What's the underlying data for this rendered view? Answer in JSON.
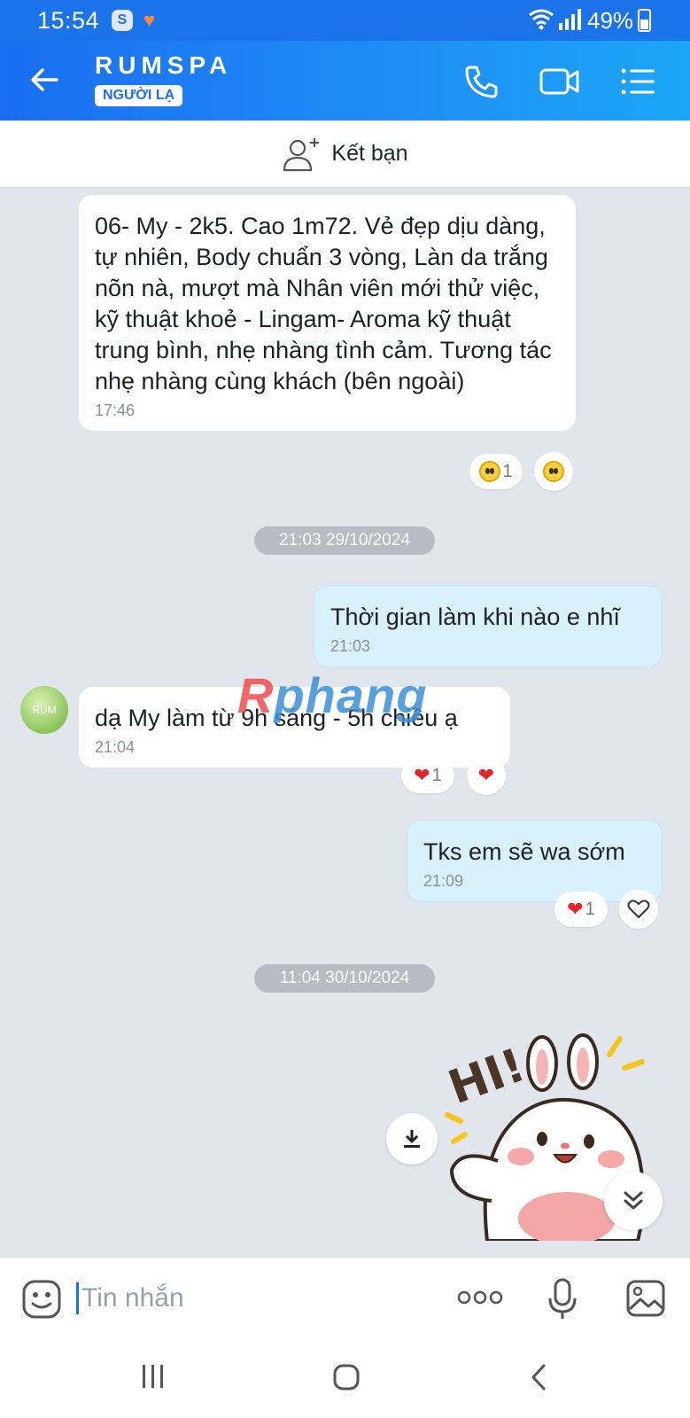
{
  "status": {
    "time": "15:54",
    "battery": "49%",
    "app_badge": "S"
  },
  "header": {
    "title": "RUMSPA",
    "badge": "NGƯỜI LẠ"
  },
  "add_friend": {
    "label": "Kết bạn"
  },
  "messages": [
    {
      "dir": "in",
      "text": "06- My - 2k5. Cao 1m72. Vẻ đẹp dịu dàng, tự nhiên, Body chuẩn 3 vòng, Làn da trắng nõn nà, mượt mà Nhân viên mới thử việc, kỹ thuật khoẻ - Lingam- Aroma kỹ thuật trung bình, nhẹ nhàng tình cảm. Tương tác nhẹ nhàng cùng khách (bên ngoài)",
      "time": "17:46",
      "reaction_count": "1"
    },
    {
      "dir": "out",
      "text": "Thời gian làm khi nào e nhĩ",
      "time": "21:03"
    },
    {
      "dir": "in",
      "text": "dạ My làm từ 9h sáng - 5h chiều ạ",
      "time": "21:04",
      "reaction_count": "1"
    },
    {
      "dir": "out",
      "text": "Tks em sẽ wa sớm",
      "time": "21:09",
      "reaction_count": "1"
    }
  ],
  "dates": [
    "21:03 29/10/2024",
    "11:04 30/10/2024"
  ],
  "avatar_label": "RUM",
  "watermark": {
    "part1": "R",
    "part2": "phang"
  },
  "input": {
    "placeholder": "Tin nhắn"
  },
  "colors": {
    "header": "#1a73e8",
    "outgoing": "#d9f1fd",
    "incoming": "#ffffff",
    "background": "#e1e6ec"
  }
}
